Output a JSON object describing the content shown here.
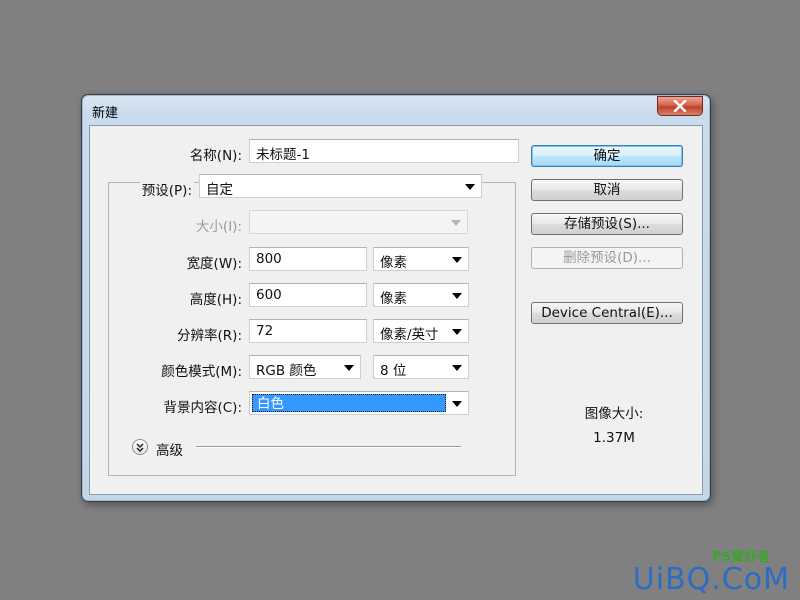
{
  "dialog": {
    "title": "新建",
    "close_icon": "close-icon"
  },
  "form": {
    "name": {
      "label": "名称(N):",
      "value": "未标题-1"
    },
    "preset": {
      "label": "预设(P):",
      "value": "自定"
    },
    "size": {
      "label": "大小(I):",
      "value": ""
    },
    "width": {
      "label": "宽度(W):",
      "value": "800",
      "unit": "像素"
    },
    "height": {
      "label": "高度(H):",
      "value": "600",
      "unit": "像素"
    },
    "resolution": {
      "label": "分辨率(R):",
      "value": "72",
      "unit": "像素/英寸"
    },
    "color_mode": {
      "label": "颜色模式(M):",
      "value": "RGB 颜色",
      "bits": "8 位"
    },
    "background": {
      "label": "背景内容(C):",
      "value": "白色"
    },
    "advanced": {
      "label": "高级"
    }
  },
  "buttons": {
    "ok": "确定",
    "cancel": "取消",
    "save_preset": "存储预设(S)...",
    "delete_preset": "删除预设(D)...",
    "device_central": "Device Central(E)..."
  },
  "image_size": {
    "label": "图像大小:",
    "value": "1.37M"
  },
  "watermark": {
    "small": "PS爱好者",
    "big": "UiBQ.CoM"
  }
}
